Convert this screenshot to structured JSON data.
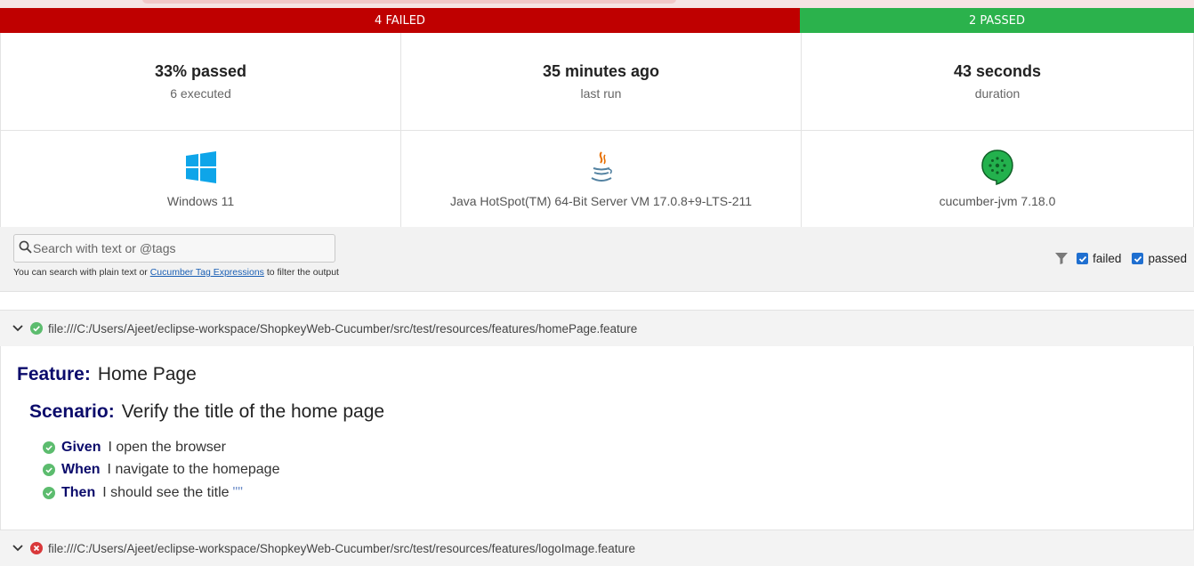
{
  "summary": {
    "failed_label": "4 FAILED",
    "passed_label": "2 PASSED",
    "failed_count": 4,
    "passed_count": 2,
    "failed_color": "#bf0000",
    "passed_color": "#2bb24c"
  },
  "stats": [
    {
      "main": "33% passed",
      "sub": "6 executed"
    },
    {
      "main": "35 minutes ago",
      "sub": "last run"
    },
    {
      "main": "43 seconds",
      "sub": "duration"
    }
  ],
  "environment": [
    {
      "icon": "windows-icon",
      "label": "Windows 11"
    },
    {
      "icon": "java-icon",
      "label": "Java HotSpot(TM) 64-Bit Server VM 17.0.8+9-LTS-211"
    },
    {
      "icon": "cucumber-icon",
      "label": "cucumber-jvm 7.18.0"
    }
  ],
  "search": {
    "placeholder": "Search with text or @tags",
    "value": "",
    "hint_prefix": "You can search with plain text or ",
    "hint_link": "Cucumber Tag Expressions",
    "hint_suffix": " to filter the output"
  },
  "filters": {
    "icon": "filter-icon",
    "items": [
      {
        "label": "failed",
        "checked": true
      },
      {
        "label": "passed",
        "checked": true
      }
    ]
  },
  "features": [
    {
      "status": "passed",
      "path": "file:///C:/Users/Ajeet/eclipse-workspace/ShopkeyWeb-Cucumber/src/test/resources/features/homePage.feature",
      "feature_keyword": "Feature:",
      "feature_name": "Home Page",
      "scenario_keyword": "Scenario:",
      "scenario_name": "Verify the title of the home page",
      "steps": [
        {
          "keyword": "Given",
          "text": "I open the browser",
          "arg": ""
        },
        {
          "keyword": "When",
          "text": "I navigate to the homepage",
          "arg": ""
        },
        {
          "keyword": "Then",
          "text": "I should see the title",
          "arg": "\"\""
        }
      ]
    },
    {
      "status": "failed",
      "path": "file:///C:/Users/Ajeet/eclipse-workspace/ShopkeyWeb-Cucumber/src/test/resources/features/logoImage.feature"
    }
  ]
}
